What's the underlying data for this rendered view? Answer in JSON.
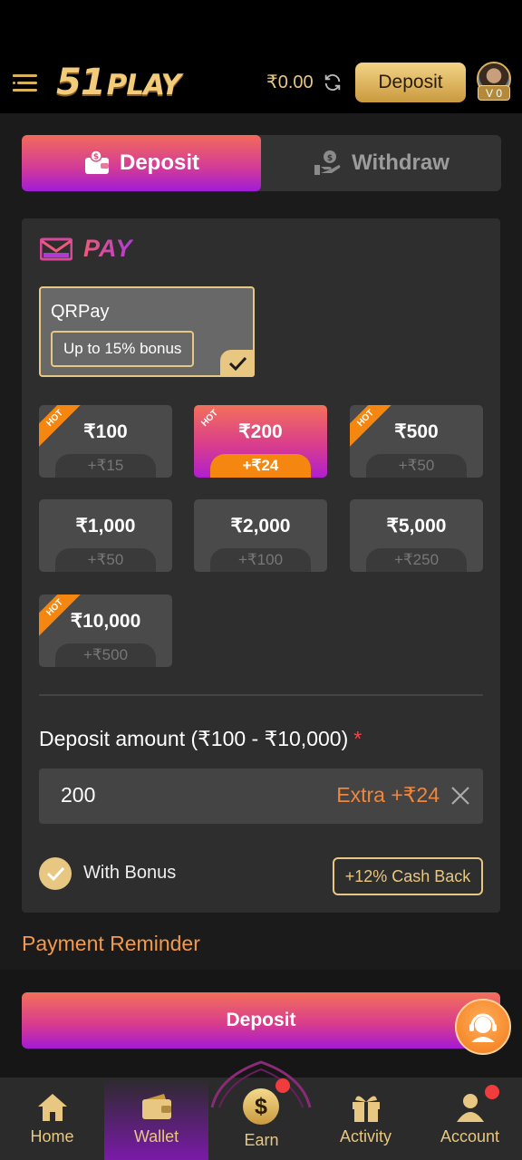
{
  "header": {
    "logo_num": "51",
    "logo_word": "PLAY",
    "balance": "₹0.00",
    "deposit_label": "Deposit",
    "vip_level": "V 0"
  },
  "tabs": [
    {
      "label": "Deposit",
      "active": true
    },
    {
      "label": "Withdraw",
      "active": false
    }
  ],
  "pay": {
    "title": "PAY",
    "method": {
      "name": "QRPay",
      "bonus": "Up to 15% bonus",
      "selected": true
    }
  },
  "amounts": [
    {
      "value": "₹100",
      "bonus": "+₹15",
      "hot": true,
      "selected": false
    },
    {
      "value": "₹200",
      "bonus": "+₹24",
      "hot": true,
      "selected": true
    },
    {
      "value": "₹500",
      "bonus": "+₹50",
      "hot": true,
      "selected": false
    },
    {
      "value": "₹1,000",
      "bonus": "+₹50",
      "hot": false,
      "selected": false
    },
    {
      "value": "₹2,000",
      "bonus": "+₹100",
      "hot": false,
      "selected": false
    },
    {
      "value": "₹5,000",
      "bonus": "+₹250",
      "hot": false,
      "selected": false
    },
    {
      "value": "₹10,000",
      "bonus": "+₹500",
      "hot": true,
      "selected": false
    }
  ],
  "hot_label": "HOT",
  "deposit_amount": {
    "label": "Deposit amount (₹100 - ₹10,000)",
    "required_mark": "*",
    "value": "200",
    "extra": "Extra +₹24"
  },
  "bonus": {
    "label": "With Bonus",
    "checked": true,
    "cashback": "+12% Cash Back"
  },
  "payment_reminder": "Payment Reminder",
  "deposit_button": "Deposit",
  "nav": [
    {
      "label": "Home",
      "icon": "home-icon",
      "active": false
    },
    {
      "label": "Wallet",
      "icon": "wallet-icon",
      "active": true
    },
    {
      "label": "Earn",
      "icon": "dollar-coin-icon",
      "active": false,
      "badge": true
    },
    {
      "label": "Activity",
      "icon": "gift-icon",
      "active": false
    },
    {
      "label": "Account",
      "icon": "user-icon",
      "active": false,
      "badge": true
    }
  ],
  "colors": {
    "accent_gold": "#e7c781",
    "orange": "#f5860f",
    "gradient_top": "#f3705a",
    "gradient_bottom": "#a41ad4"
  }
}
